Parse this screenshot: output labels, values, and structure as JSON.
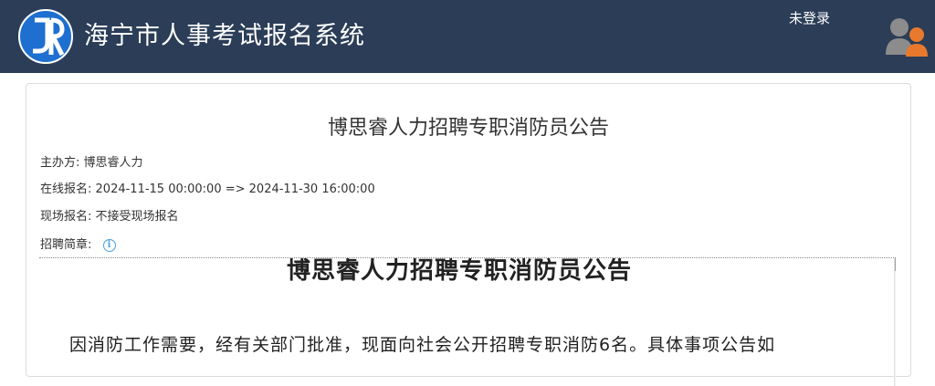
{
  "header": {
    "app_title": "海宁市人事考试报名系统",
    "login_text": "未登录",
    "logo_icon": "jr-logo-icon",
    "user_icon": "user-group-icon",
    "background_color": "#2b3d57",
    "logo_color": "#1f6fd1"
  },
  "notice": {
    "title": "博思睿人力招聘专职消防员公告",
    "organizer_label": "主办方:",
    "organizer_value": "博思睿人力",
    "online_label": "在线报名:",
    "online_value": "2024-11-15 00:00:00 => 2024-11-30 16:00:00",
    "onsite_label": "现场报名:",
    "onsite_value": "不接受现场报名",
    "brief_label": "招聘简章:",
    "brief_icon": "info-icon"
  },
  "document": {
    "title": "博思睿人力招聘专职消防员公告",
    "paragraph": "因消防工作需要，经有关部门批准，现面向社会公开招聘专职消防6名。具体事项公告如"
  }
}
